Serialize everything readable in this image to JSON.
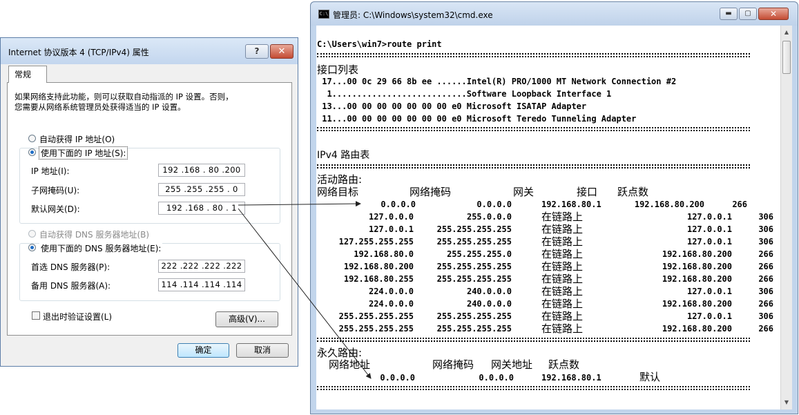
{
  "dialog": {
    "title": "Internet 协议版本 4 (TCP/IPv4) 属性",
    "help_label": "?",
    "close_label": "✕",
    "tab_general": "常规",
    "intro_line1": "如果网络支持此功能，则可以获取自动指派的 IP 设置。否则，",
    "intro_line2": "您需要从网络系统管理员处获得适当的 IP 设置。",
    "auto_ip_label": "自动获得 IP 地址(O)",
    "manual_ip_label": "使用下面的 IP 地址(S):",
    "ip_address_label": "IP 地址(I):",
    "ip_address_value": "192 .168 . 80 .200",
    "subnet_mask_label": "子网掩码(U):",
    "subnet_mask_value": "255 .255 .255 .  0",
    "gateway_label": "默认网关(D):",
    "gateway_value": "192 .168 . 80 .  1",
    "auto_dns_label": "自动获得 DNS 服务器地址(B)",
    "manual_dns_label": "使用下面的 DNS 服务器地址(E):",
    "preferred_dns_label": "首选 DNS 服务器(P):",
    "preferred_dns_value": "222 .222 .222 .222",
    "alternate_dns_label": "备用 DNS 服务器(A):",
    "alternate_dns_value": "114 .114 .114 .114",
    "validate_label": "退出时验证设置(L)",
    "advanced_label": "高级(V)...",
    "ok_label": "确定",
    "cancel_label": "取消"
  },
  "cmd": {
    "title": "管理员: C:\\Windows\\system32\\cmd.exe",
    "min_label": "▬",
    "max_label": "▢",
    "close_label": "✕",
    "scroll_up": "▲",
    "scroll_down": "▼",
    "prompt": "C:\\Users\\win7>route print",
    "interface_list_title": "接口列表",
    "interfaces": [
      " 17...00 0c 29 66 8b ee ......Intel(R) PRO/1000 MT Network Connection #2",
      "  1...........................Software Loopback Interface 1",
      " 13...00 00 00 00 00 00 00 e0 Microsoft ISATAP Adapter",
      " 11...00 00 00 00 00 00 00 e0 Microsoft Teredo Tunneling Adapter"
    ],
    "ipv4_title": "IPv4 路由表",
    "active_routes_title": "活动路由:",
    "headers": {
      "destination": "网络目标",
      "netmask": "网络掩码",
      "gateway": "网关",
      "interface": "接口",
      "metric": "跃点数"
    },
    "routes": [
      {
        "dest": "0.0.0.0",
        "mask": "0.0.0.0",
        "gw": "192.168.80.1",
        "iface": "192.168.80.200",
        "metric": "266"
      },
      {
        "dest": "127.0.0.0",
        "mask": "255.0.0.0",
        "gw": "在链路上",
        "iface": "127.0.0.1",
        "metric": "306"
      },
      {
        "dest": "127.0.0.1",
        "mask": "255.255.255.255",
        "gw": "在链路上",
        "iface": "127.0.0.1",
        "metric": "306"
      },
      {
        "dest": "127.255.255.255",
        "mask": "255.255.255.255",
        "gw": "在链路上",
        "iface": "127.0.0.1",
        "metric": "306"
      },
      {
        "dest": "192.168.80.0",
        "mask": "255.255.255.0",
        "gw": "在链路上",
        "iface": "192.168.80.200",
        "metric": "266"
      },
      {
        "dest": "192.168.80.200",
        "mask": "255.255.255.255",
        "gw": "在链路上",
        "iface": "192.168.80.200",
        "metric": "266"
      },
      {
        "dest": "192.168.80.255",
        "mask": "255.255.255.255",
        "gw": "在链路上",
        "iface": "192.168.80.200",
        "metric": "266"
      },
      {
        "dest": "224.0.0.0",
        "mask": "240.0.0.0",
        "gw": "在链路上",
        "iface": "127.0.0.1",
        "metric": "306"
      },
      {
        "dest": "224.0.0.0",
        "mask": "240.0.0.0",
        "gw": "在链路上",
        "iface": "192.168.80.200",
        "metric": "266"
      },
      {
        "dest": "255.255.255.255",
        "mask": "255.255.255.255",
        "gw": "在链路上",
        "iface": "127.0.0.1",
        "metric": "306"
      },
      {
        "dest": "255.255.255.255",
        "mask": "255.255.255.255",
        "gw": "在链路上",
        "iface": "192.168.80.200",
        "metric": "266"
      }
    ],
    "persistent_routes_title": "永久路由:",
    "persistent_headers": {
      "address": "网络地址",
      "netmask": "网络掩码",
      "gateway": "网关地址",
      "metric": "跃点数"
    },
    "persistent_route": {
      "address": "0.0.0.0",
      "mask": "0.0.0.0",
      "gw": "192.168.80.1",
      "metric": "默认"
    }
  }
}
